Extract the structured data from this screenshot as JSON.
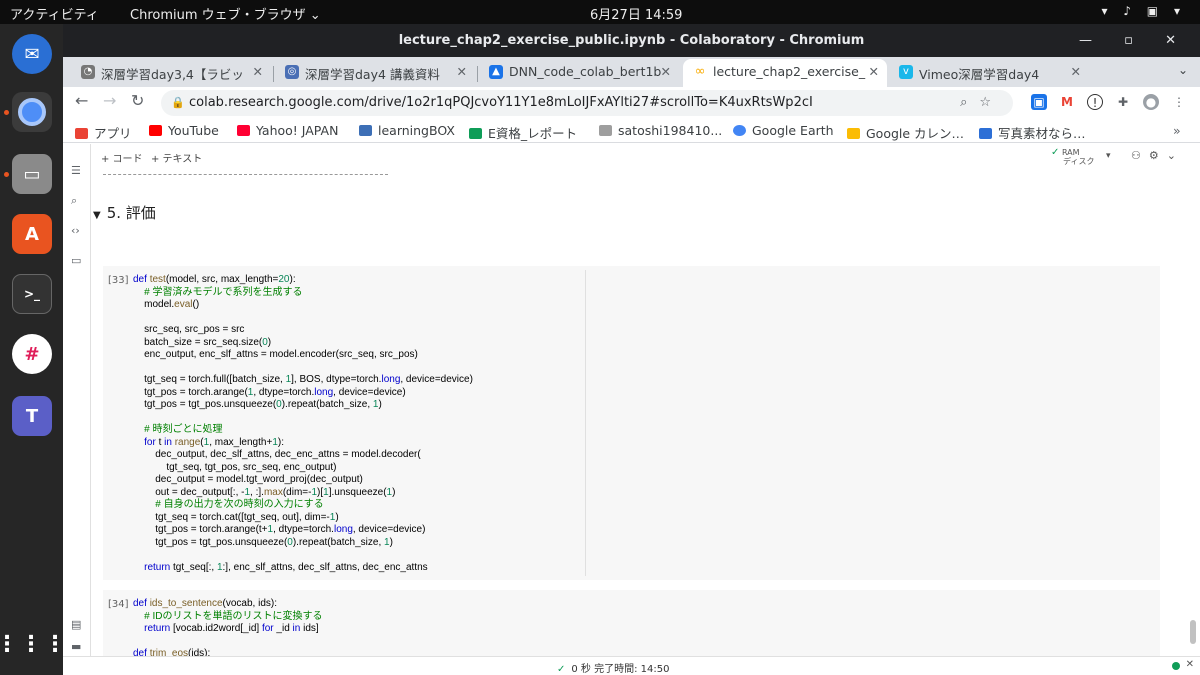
{
  "system": {
    "activities": "アクティビティ",
    "app_menu": "Chromium ウェブ・ブラウザ ⌄",
    "clock": "6月27日  14:59"
  },
  "window": {
    "title": "lecture_chap2_exercise_public.ipynb - Colaboratory - Chromium"
  },
  "tabs": [
    {
      "label": "深層学習day3,4【ラビッ",
      "color": "#777777"
    },
    {
      "label": "深層学習day4 講義資料",
      "color": "#4a6fb5"
    },
    {
      "label": "DNN_code_colab_bert1b",
      "color": "#1a73e8"
    },
    {
      "label": "lecture_chap2_exercise_",
      "color": "#f9ab00"
    },
    {
      "label": "Vimeo深層学習day4",
      "color": "#1ab7ea"
    }
  ],
  "omnibox": {
    "url": "colab.research.google.com/drive/1o2r1qPQJcvoY11Y1e8mLoIJFxAYlti27#scrollTo=K4uxRtsWp2cI"
  },
  "bookmarks": [
    {
      "label": "アプリ",
      "color": "#ea4335"
    },
    {
      "label": "YouTube",
      "color": "#ff0000"
    },
    {
      "label": "Yahoo! JAPAN",
      "color": "#ff0033"
    },
    {
      "label": "learningBOX",
      "color": "#3d6fb6"
    },
    {
      "label": "E資格_レポート",
      "color": "#0f9d58"
    },
    {
      "label": "satoshi198410...",
      "color": "#9e9e9e"
    },
    {
      "label": "Google Earth",
      "color": "#4285f4"
    },
    {
      "label": "Google カレン…",
      "color": "#fbbc04"
    },
    {
      "label": "写真素材なら…",
      "color": "#2d6fd6"
    }
  ],
  "notebook": {
    "add_code": "+ コード",
    "add_text": "+ テキスト",
    "ram": "RAM",
    "disk": "ディスク",
    "section_title": "5. 評価",
    "cell1_num": "[33]",
    "cell2_num": "[34]",
    "status": "0 秒    完了時間: 14:50"
  }
}
